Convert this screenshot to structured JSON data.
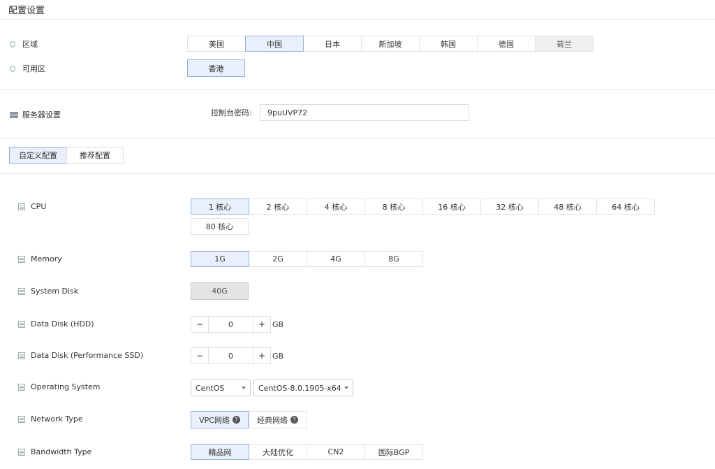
{
  "page": {
    "title": "配置设置"
  },
  "region": {
    "label": "区域",
    "options": [
      "美国",
      "中国",
      "日本",
      "新加坡",
      "韩国",
      "德国",
      "荷兰"
    ],
    "selected_index": 1,
    "disabled_index": 6
  },
  "zone": {
    "label": "可用区",
    "options": [
      "香港"
    ],
    "selected_index": 0
  },
  "server": {
    "label": "服务器设置",
    "console_password_label": "控制台密码:",
    "console_password_value": "9puUVP72"
  },
  "config_tabs": {
    "items": [
      "自定义配置",
      "推荐配置"
    ],
    "selected_index": 0
  },
  "cpu": {
    "label": "CPU",
    "options": [
      "1 核心",
      "2 核心",
      "4 核心",
      "8 核心",
      "16 核心",
      "32 核心",
      "48 核心",
      "64 核心",
      "80 核心"
    ],
    "selected_index": 0
  },
  "memory": {
    "label": "Memory",
    "options": [
      "1G",
      "2G",
      "4G",
      "8G"
    ],
    "selected_index": 0
  },
  "system_disk": {
    "label": "System Disk",
    "options": [
      "40G"
    ],
    "selected_index": 0
  },
  "data_disk_hdd": {
    "label": "Data Disk (HDD)",
    "minus": "−",
    "value": "0",
    "plus": "+",
    "unit": "GB"
  },
  "data_disk_ssd": {
    "label": "Data Disk (Performance SSD)",
    "minus": "−",
    "value": "0",
    "plus": "+",
    "unit": "GB"
  },
  "os": {
    "label": "Operating System",
    "distro_value": "CentOS",
    "version_value": "CentOS-8.0.1905-x64"
  },
  "network": {
    "label": "Network Type",
    "options": [
      "VPC网络",
      "经典网络"
    ],
    "selected_index": 0,
    "help_glyph": "?"
  },
  "bandwidth": {
    "label": "Bandwidth Type",
    "options": [
      "精品网",
      "大陆优化",
      "CN2",
      "国际BGP"
    ],
    "selected_index": 0
  },
  "colors": {
    "selected_bg": "#e9f0fb",
    "selected_border": "#93b2e2",
    "border": "#e2e2e2",
    "divider": "#e5e5e5"
  }
}
